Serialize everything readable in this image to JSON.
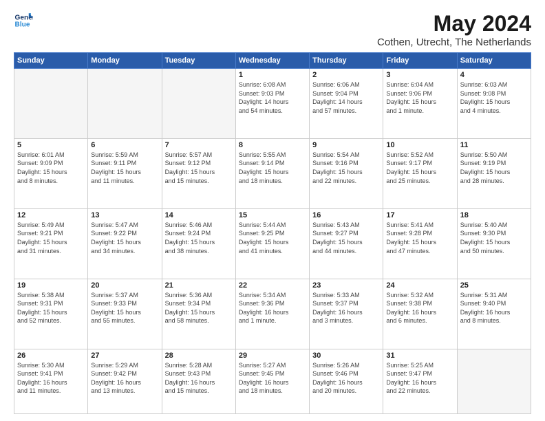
{
  "header": {
    "logo_line1": "General",
    "logo_line2": "Blue",
    "month": "May 2024",
    "location": "Cothen, Utrecht, The Netherlands"
  },
  "weekdays": [
    "Sunday",
    "Monday",
    "Tuesday",
    "Wednesday",
    "Thursday",
    "Friday",
    "Saturday"
  ],
  "weeks": [
    [
      {
        "day": "",
        "info": ""
      },
      {
        "day": "",
        "info": ""
      },
      {
        "day": "",
        "info": ""
      },
      {
        "day": "1",
        "info": "Sunrise: 6:08 AM\nSunset: 9:03 PM\nDaylight: 14 hours\nand 54 minutes."
      },
      {
        "day": "2",
        "info": "Sunrise: 6:06 AM\nSunset: 9:04 PM\nDaylight: 14 hours\nand 57 minutes."
      },
      {
        "day": "3",
        "info": "Sunrise: 6:04 AM\nSunset: 9:06 PM\nDaylight: 15 hours\nand 1 minute."
      },
      {
        "day": "4",
        "info": "Sunrise: 6:03 AM\nSunset: 9:08 PM\nDaylight: 15 hours\nand 4 minutes."
      }
    ],
    [
      {
        "day": "5",
        "info": "Sunrise: 6:01 AM\nSunset: 9:09 PM\nDaylight: 15 hours\nand 8 minutes."
      },
      {
        "day": "6",
        "info": "Sunrise: 5:59 AM\nSunset: 9:11 PM\nDaylight: 15 hours\nand 11 minutes."
      },
      {
        "day": "7",
        "info": "Sunrise: 5:57 AM\nSunset: 9:12 PM\nDaylight: 15 hours\nand 15 minutes."
      },
      {
        "day": "8",
        "info": "Sunrise: 5:55 AM\nSunset: 9:14 PM\nDaylight: 15 hours\nand 18 minutes."
      },
      {
        "day": "9",
        "info": "Sunrise: 5:54 AM\nSunset: 9:16 PM\nDaylight: 15 hours\nand 22 minutes."
      },
      {
        "day": "10",
        "info": "Sunrise: 5:52 AM\nSunset: 9:17 PM\nDaylight: 15 hours\nand 25 minutes."
      },
      {
        "day": "11",
        "info": "Sunrise: 5:50 AM\nSunset: 9:19 PM\nDaylight: 15 hours\nand 28 minutes."
      }
    ],
    [
      {
        "day": "12",
        "info": "Sunrise: 5:49 AM\nSunset: 9:21 PM\nDaylight: 15 hours\nand 31 minutes."
      },
      {
        "day": "13",
        "info": "Sunrise: 5:47 AM\nSunset: 9:22 PM\nDaylight: 15 hours\nand 34 minutes."
      },
      {
        "day": "14",
        "info": "Sunrise: 5:46 AM\nSunset: 9:24 PM\nDaylight: 15 hours\nand 38 minutes."
      },
      {
        "day": "15",
        "info": "Sunrise: 5:44 AM\nSunset: 9:25 PM\nDaylight: 15 hours\nand 41 minutes."
      },
      {
        "day": "16",
        "info": "Sunrise: 5:43 AM\nSunset: 9:27 PM\nDaylight: 15 hours\nand 44 minutes."
      },
      {
        "day": "17",
        "info": "Sunrise: 5:41 AM\nSunset: 9:28 PM\nDaylight: 15 hours\nand 47 minutes."
      },
      {
        "day": "18",
        "info": "Sunrise: 5:40 AM\nSunset: 9:30 PM\nDaylight: 15 hours\nand 50 minutes."
      }
    ],
    [
      {
        "day": "19",
        "info": "Sunrise: 5:38 AM\nSunset: 9:31 PM\nDaylight: 15 hours\nand 52 minutes."
      },
      {
        "day": "20",
        "info": "Sunrise: 5:37 AM\nSunset: 9:33 PM\nDaylight: 15 hours\nand 55 minutes."
      },
      {
        "day": "21",
        "info": "Sunrise: 5:36 AM\nSunset: 9:34 PM\nDaylight: 15 hours\nand 58 minutes."
      },
      {
        "day": "22",
        "info": "Sunrise: 5:34 AM\nSunset: 9:36 PM\nDaylight: 16 hours\nand 1 minute."
      },
      {
        "day": "23",
        "info": "Sunrise: 5:33 AM\nSunset: 9:37 PM\nDaylight: 16 hours\nand 3 minutes."
      },
      {
        "day": "24",
        "info": "Sunrise: 5:32 AM\nSunset: 9:38 PM\nDaylight: 16 hours\nand 6 minutes."
      },
      {
        "day": "25",
        "info": "Sunrise: 5:31 AM\nSunset: 9:40 PM\nDaylight: 16 hours\nand 8 minutes."
      }
    ],
    [
      {
        "day": "26",
        "info": "Sunrise: 5:30 AM\nSunset: 9:41 PM\nDaylight: 16 hours\nand 11 minutes."
      },
      {
        "day": "27",
        "info": "Sunrise: 5:29 AM\nSunset: 9:42 PM\nDaylight: 16 hours\nand 13 minutes."
      },
      {
        "day": "28",
        "info": "Sunrise: 5:28 AM\nSunset: 9:43 PM\nDaylight: 16 hours\nand 15 minutes."
      },
      {
        "day": "29",
        "info": "Sunrise: 5:27 AM\nSunset: 9:45 PM\nDaylight: 16 hours\nand 18 minutes."
      },
      {
        "day": "30",
        "info": "Sunrise: 5:26 AM\nSunset: 9:46 PM\nDaylight: 16 hours\nand 20 minutes."
      },
      {
        "day": "31",
        "info": "Sunrise: 5:25 AM\nSunset: 9:47 PM\nDaylight: 16 hours\nand 22 minutes."
      },
      {
        "day": "",
        "info": ""
      }
    ]
  ]
}
